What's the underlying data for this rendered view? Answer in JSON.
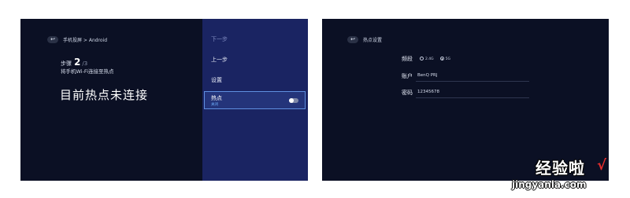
{
  "left": {
    "breadcrumb": "手机投屏 > Android",
    "step_prefix": "步骤",
    "step_current": "2",
    "step_total": "/3",
    "instruction": "将手机Wi-Fi连接至热点",
    "status": "目前热点未连接",
    "menu": {
      "next": "下一步",
      "prev": "上一步",
      "settings": "设置",
      "hotspot_label": "热点",
      "hotspot_state": "关闭"
    }
  },
  "right": {
    "title": "热点设置",
    "band_label": "频段",
    "band_options": [
      "2.4G",
      "5G"
    ],
    "band_selected": "5G",
    "account_label": "账户",
    "account_value": "BenQ PRJ",
    "password_label": "密码",
    "password_value": "12345678"
  },
  "watermark": {
    "title": "经验啦",
    "url": "jingyanla.com"
  },
  "colors": {
    "screen_bg": "#0b1024",
    "menu_bg": "#1a2462",
    "highlight_border": "#5f8fe0",
    "state_blue": "#6fb2ff",
    "check_red": "#e52d2d"
  }
}
